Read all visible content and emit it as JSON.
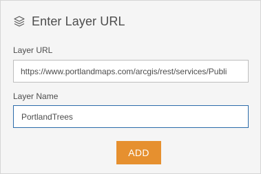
{
  "header": {
    "icon": "layers-icon",
    "title": "Enter Layer URL"
  },
  "form": {
    "url_label": "Layer URL",
    "url_value": "https://www.portlandmaps.com/arcgis/rest/services/Publi",
    "name_label": "Layer Name",
    "name_value": "PortlandTrees"
  },
  "actions": {
    "add_label": "ADD"
  },
  "colors": {
    "accent": "#e6902f",
    "focus_border": "#2a6aa9",
    "panel_bg": "#f5f5f5"
  }
}
